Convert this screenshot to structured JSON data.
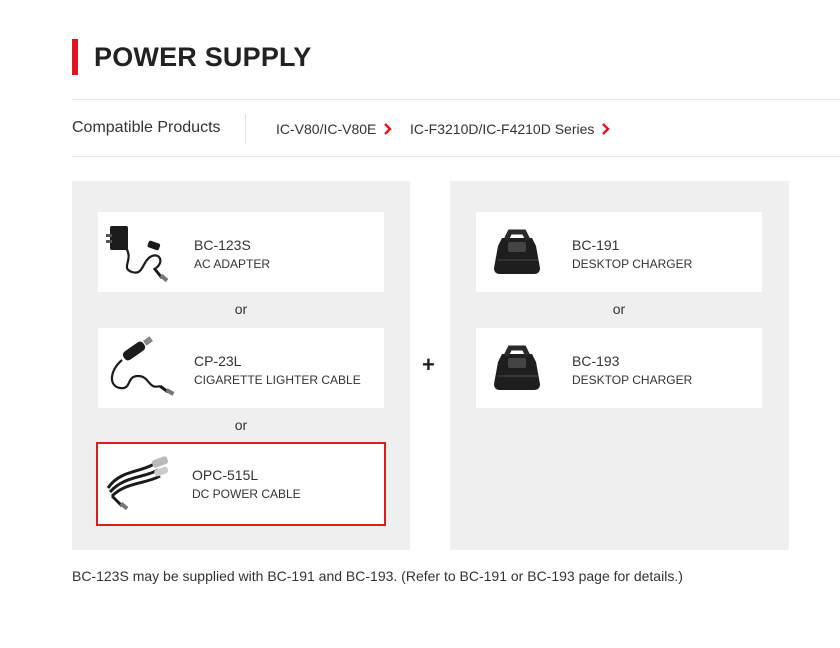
{
  "page": {
    "title": "POWER SUPPLY"
  },
  "compatible": {
    "label": "Compatible Products",
    "links": [
      {
        "label": "IC-V80/IC-V80E"
      },
      {
        "label": "IC-F3210D/IC-F4210D Series"
      }
    ]
  },
  "power_options": [
    {
      "model": "BC-123S",
      "desc": "AC ADAPTER",
      "icon": "ac-adapter-icon"
    },
    {
      "model": "CP-23L",
      "desc": "CIGARETTE LIGHTER CABLE",
      "icon": "cigarette-cable-icon"
    },
    {
      "model": "OPC-515L",
      "desc": "DC POWER CABLE",
      "icon": "dc-cable-icon",
      "selected": true
    }
  ],
  "chargers": [
    {
      "model": "BC-191",
      "desc": "DESKTOP CHARGER",
      "icon": "desktop-charger-icon"
    },
    {
      "model": "BC-193",
      "desc": "DESKTOP CHARGER",
      "icon": "desktop-charger-icon"
    }
  ],
  "or_label": "or",
  "plus_label": "+",
  "note": "BC-123S may be supplied with BC-191 and BC-193. (Refer to BC-191 or BC-193 page for details.)",
  "colors": {
    "accent": "#e0141e",
    "panel": "#efefef",
    "selected_border": "#d81e1e"
  }
}
